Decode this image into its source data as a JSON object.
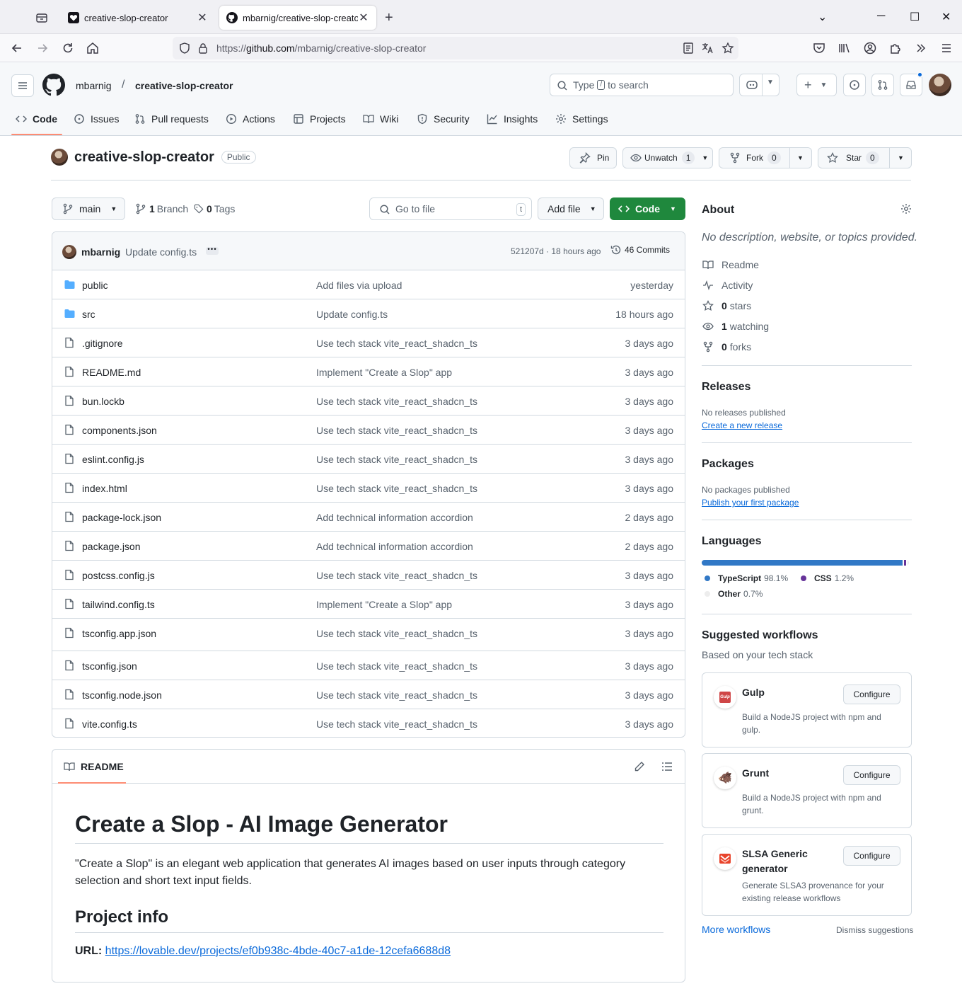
{
  "browser": {
    "tabs": [
      {
        "title": "creative-slop-creator",
        "active": false
      },
      {
        "title": "mbarnig/creative-slop-creator",
        "active": true
      }
    ],
    "url_prefix": "https://",
    "url_host": "github.com",
    "url_path": "/mbarnig/creative-slop-creator"
  },
  "header": {
    "owner": "mbarnig",
    "separator": "/",
    "repo": "creative-slop-creator",
    "search_type": "Type",
    "search_key": "/",
    "search_rest": "to search"
  },
  "repo_nav": [
    {
      "label": "Code",
      "icon": "code-icon"
    },
    {
      "label": "Issues",
      "icon": "issue-icon"
    },
    {
      "label": "Pull requests",
      "icon": "pull-request-icon"
    },
    {
      "label": "Actions",
      "icon": "play-icon"
    },
    {
      "label": "Projects",
      "icon": "table-icon"
    },
    {
      "label": "Wiki",
      "icon": "book-icon"
    },
    {
      "label": "Security",
      "icon": "shield-icon"
    },
    {
      "label": "Insights",
      "icon": "graph-icon"
    },
    {
      "label": "Settings",
      "icon": "gear-icon"
    }
  ],
  "repo": {
    "name": "creative-slop-creator",
    "visibility": "Public",
    "pin": "Pin",
    "unwatch": "Unwatch",
    "watch_count": "1",
    "fork": "Fork",
    "fork_count": "0",
    "star": "Star",
    "star_count": "0"
  },
  "toolbar": {
    "branch": "main",
    "branch_count": "1",
    "branch_label": "Branch",
    "tag_count": "0",
    "tag_label": "Tags",
    "goto_placeholder": "Go to file",
    "goto_key": "t",
    "add_file": "Add file",
    "code": "Code"
  },
  "last_commit": {
    "author": "mbarnig",
    "message": "Update config.ts",
    "sha_time": "521207d · 18 hours ago",
    "commits": "46 Commits"
  },
  "files": [
    {
      "name": "public",
      "type": "dir",
      "commit": "Add files via upload",
      "time": "yesterday"
    },
    {
      "name": "src",
      "type": "dir",
      "commit": "Update config.ts",
      "time": "18 hours ago"
    },
    {
      "name": ".gitignore",
      "type": "file",
      "commit": "Use tech stack vite_react_shadcn_ts",
      "time": "3 days ago"
    },
    {
      "name": "README.md",
      "type": "file",
      "commit": "Implement \"Create a Slop\" app",
      "time": "3 days ago"
    },
    {
      "name": "bun.lockb",
      "type": "file",
      "commit": "Use tech stack vite_react_shadcn_ts",
      "time": "3 days ago"
    },
    {
      "name": "components.json",
      "type": "file",
      "commit": "Use tech stack vite_react_shadcn_ts",
      "time": "3 days ago"
    },
    {
      "name": "eslint.config.js",
      "type": "file",
      "commit": "Use tech stack vite_react_shadcn_ts",
      "time": "3 days ago"
    },
    {
      "name": "index.html",
      "type": "file",
      "commit": "Use tech stack vite_react_shadcn_ts",
      "time": "3 days ago"
    },
    {
      "name": "package-lock.json",
      "type": "file",
      "commit": "Add technical information accordion",
      "time": "2 days ago"
    },
    {
      "name": "package.json",
      "type": "file",
      "commit": "Add technical information accordion",
      "time": "2 days ago"
    },
    {
      "name": "postcss.config.js",
      "type": "file",
      "commit": "Use tech stack vite_react_shadcn_ts",
      "time": "3 days ago"
    },
    {
      "name": "tailwind.config.ts",
      "type": "file",
      "commit": "Implement \"Create a Slop\" app",
      "time": "3 days ago"
    },
    {
      "name": "tsconfig.app.json",
      "type": "file",
      "commit": "Use tech stack vite_react_shadcn_ts",
      "time": "3 days ago"
    },
    {
      "name": "tsconfig.json",
      "type": "file",
      "commit": "Use tech stack vite_react_shadcn_ts",
      "time": "3 days ago"
    },
    {
      "name": "tsconfig.node.json",
      "type": "file",
      "commit": "Use tech stack vite_react_shadcn_ts",
      "time": "3 days ago"
    },
    {
      "name": "vite.config.ts",
      "type": "file",
      "commit": "Use tech stack vite_react_shadcn_ts",
      "time": "3 days ago"
    }
  ],
  "readme": {
    "tab": "README",
    "h1": "Create a Slop - AI Image Generator",
    "p1": "\"Create a Slop\" is an elegant web application that generates AI images based on user inputs through category selection and short text input fields.",
    "h2": "Project info",
    "url_label": "URL:",
    "url": "https://lovable.dev/projects/ef0b938c-4bde-40c7-a1de-12cefa6688d8"
  },
  "about": {
    "title": "About",
    "description": "No description, website, or topics provided.",
    "readme": "Readme",
    "activity": "Activity",
    "stars_count": "0",
    "stars": "stars",
    "watching_count": "1",
    "watching": "watching",
    "forks_count": "0",
    "forks": "forks"
  },
  "releases": {
    "title": "Releases",
    "note": "No releases published",
    "link": "Create a new release"
  },
  "packages": {
    "title": "Packages",
    "note": "No packages published",
    "link": "Publish your first package"
  },
  "languages": {
    "title": "Languages",
    "items": [
      {
        "name": "TypeScript",
        "percent": "98.1%",
        "value": 98.1,
        "color": "#3178c6"
      },
      {
        "name": "CSS",
        "percent": "1.2%",
        "value": 1.2,
        "color": "#663399"
      },
      {
        "name": "Other",
        "percent": "0.7%",
        "value": 0.7,
        "color": "#ededed"
      }
    ]
  },
  "workflows": {
    "title": "Suggested workflows",
    "subtitle": "Based on your tech stack",
    "configure": "Configure",
    "items": [
      {
        "name": "Gulp",
        "desc": "Build a NodeJS project with npm and gulp."
      },
      {
        "name": "Grunt",
        "desc": "Build a NodeJS project with npm and grunt."
      },
      {
        "name": "SLSA Generic generator",
        "desc": "Generate SLSA3 provenance for your existing release workflows"
      }
    ],
    "more": "More workflows",
    "dismiss": "Dismiss suggestions"
  },
  "colors": {
    "accent": "#0969da",
    "primary_button": "#1f883d",
    "tab_underline": "#fd8c73",
    "folder": "#54aeff"
  }
}
